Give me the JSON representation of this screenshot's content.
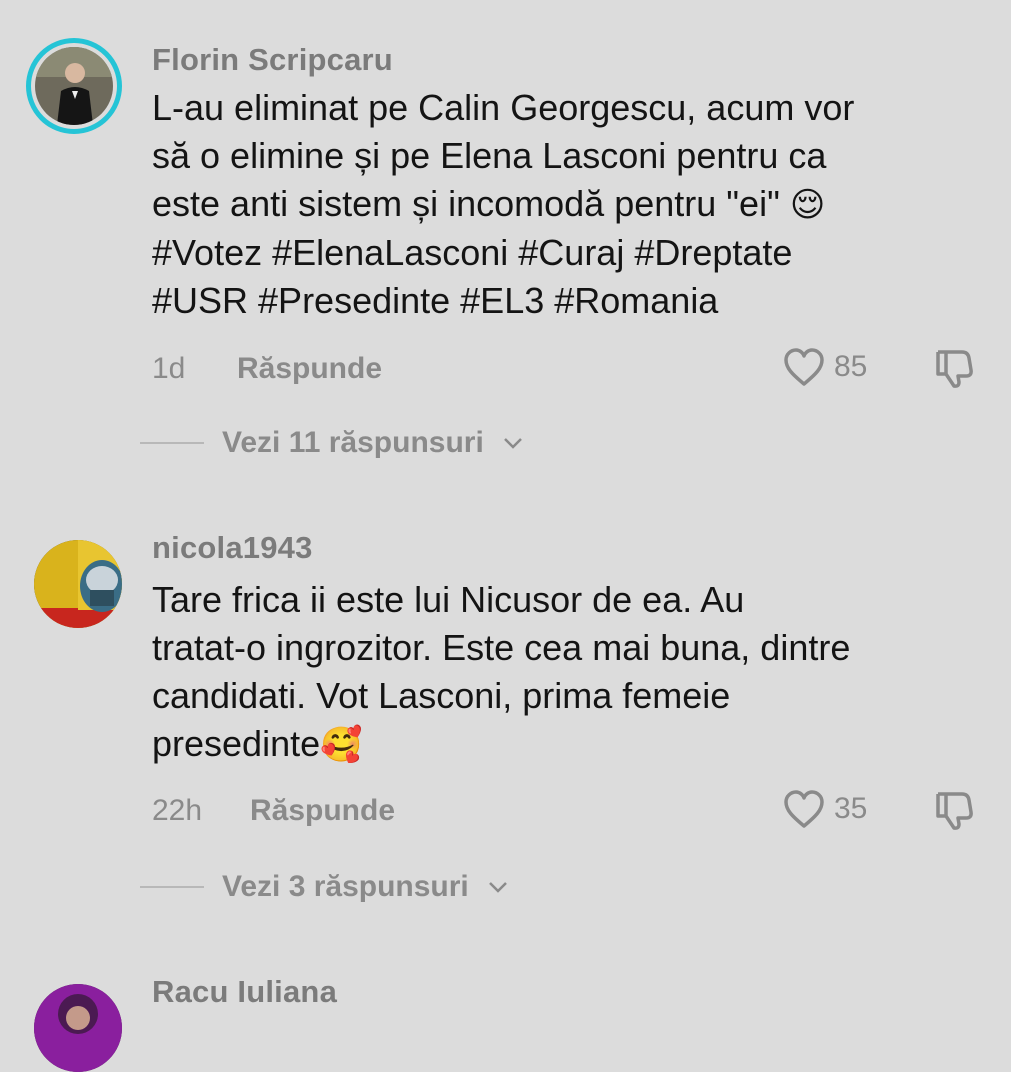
{
  "comments": [
    {
      "username": "Florin Scripcaru",
      "text": "L-au eliminat pe Calin Georgescu, acum vor\nsă o elimine și pe Elena Lasconi pentru ca\neste anti sistem și incomodă pentru \"ei\" ",
      "emoji": "😌",
      "hashtags": "#Votez #ElenaLasconi #Curaj #Dreptate\n#USR #Presedinte #EL3 #Romania",
      "time": "1d",
      "reply_label": "Răspunde",
      "likes": "85",
      "replies_label": "Vezi 11 răspunsuri",
      "avatar_icon": "user-avatar-icon"
    },
    {
      "username": "nicola1943",
      "text": "Tare frica ii este lui Nicusor de ea. Au\ntratat-o ingrozitor. Este cea mai buna, dintre\ncandidati. Vot Lasconi, prima femeie\npresedinte",
      "emoji": "🥰",
      "time": "22h",
      "reply_label": "Răspunde",
      "likes": "35",
      "replies_label": "Vezi 3 răspunsuri",
      "avatar_icon": "user-avatar-icon"
    },
    {
      "username": "Racu Iuliana",
      "avatar_icon": "user-avatar-icon"
    }
  ],
  "colors": {
    "background": "#dcdcdc",
    "ring": "#25c4d6",
    "muted": "#8a8a8a"
  }
}
